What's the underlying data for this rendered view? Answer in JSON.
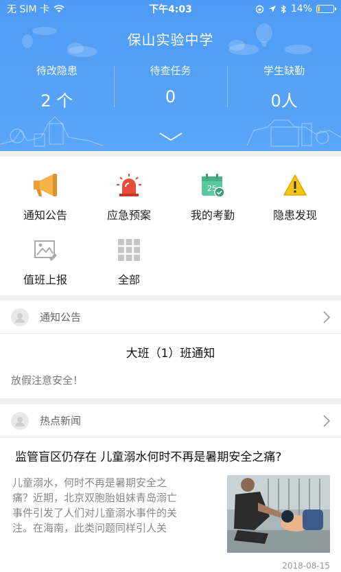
{
  "statusbar": {
    "carrier": "无 SIM 卡",
    "time": "下午4:03",
    "battery": "14%",
    "battery_level": 0.14
  },
  "header": {
    "title": "保山实验中学",
    "stats": [
      {
        "label": "待改隐患",
        "value": "2 个"
      },
      {
        "label": "待查任务",
        "value": "0"
      },
      {
        "label": "学生缺勤",
        "value": "0人"
      }
    ]
  },
  "menu": {
    "items": [
      {
        "label": "通知公告",
        "icon": "megaphone-icon"
      },
      {
        "label": "应急预案",
        "icon": "siren-icon"
      },
      {
        "label": "我的考勤",
        "icon": "calendar-check-icon",
        "badge": "25"
      },
      {
        "label": "隐患发现",
        "icon": "warning-icon"
      },
      {
        "label": "值班上报",
        "icon": "image-report-icon"
      },
      {
        "label": "全部",
        "icon": "grid-icon"
      }
    ]
  },
  "notice": {
    "section_title": "通知公告",
    "title": "大班（1）班通知",
    "body": "放假注意安全！"
  },
  "news": {
    "section_title": "热点新闻",
    "title": "监管盲区仍存在 儿童溺水何时不再是暑期安全之痛?",
    "body_lines": [
      "儿童溺水，何时不再是暑期安全之",
      "痛？近期，北京双胞胎姐妹青岛溺亡",
      "事件引发了人们对儿童溺水事件的关",
      "注。在海南，此类问题同样引人关"
    ],
    "date": "2018-08-15"
  },
  "colors": {
    "header_blue": "#4d9bf5",
    "accent_orange": "#f0a030",
    "siren_red": "#e84c3d",
    "calendar_green": "#5cc9a0",
    "warning_yellow": "#f5c518"
  }
}
